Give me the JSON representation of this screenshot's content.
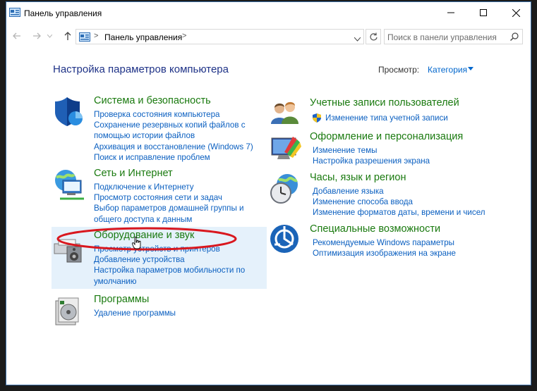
{
  "window": {
    "title": "Панель управления",
    "controls": {
      "minimize": "minimize",
      "maximize": "maximize",
      "close": "close"
    }
  },
  "address": {
    "path": "Панель управления",
    "search_placeholder": "Поиск в панели управления"
  },
  "header": {
    "title": "Настройка параметров компьютера",
    "view_label": "Просмотр:",
    "view_value": "Категория"
  },
  "categories": {
    "system": {
      "title": "Система и безопасность",
      "links": [
        "Проверка состояния компьютера",
        "Сохранение резервных копий файлов с",
        "помощью истории файлов",
        "Архивация и восстановление (Windows 7)",
        "Поиск и исправление проблем"
      ]
    },
    "network": {
      "title": "Сеть и Интернет",
      "links": [
        "Подключение к Интернету",
        "Просмотр состояния сети и задач",
        "Выбор параметров домашней группы и",
        "общего доступа к данным"
      ]
    },
    "hardware": {
      "title": "Оборудование и звук",
      "links": [
        "Просмотр устройств и принтеров",
        "Добавление устройства",
        "Настройка параметров мобильности по",
        "умолчанию"
      ]
    },
    "programs": {
      "title": "Программы",
      "links": [
        "Удаление программы"
      ]
    },
    "accounts": {
      "title": "Учетные записи пользователей",
      "links": [
        "Изменение типа учетной записи"
      ]
    },
    "appearance": {
      "title": "Оформление и персонализация",
      "links": [
        "Изменение темы",
        "Настройка разрешения экрана"
      ]
    },
    "clock": {
      "title": "Часы, язык и регион",
      "links": [
        "Добавление языка",
        "Изменение способа ввода",
        "Изменение форматов даты, времени и чисел"
      ]
    },
    "access": {
      "title": "Специальные возможности",
      "links": [
        "Рекомендуемые Windows параметры",
        "Оптимизация изображения на экране"
      ]
    }
  },
  "colors": {
    "category_title": "#1a7a0f",
    "link": "#0a5fc0",
    "page_title": "#1e3287",
    "highlight_bg": "#e5f1fb",
    "annotation": "#d9171e"
  }
}
